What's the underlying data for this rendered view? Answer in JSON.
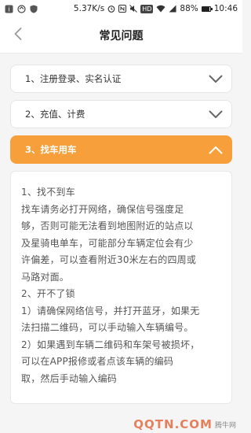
{
  "status_bar": {
    "speed": "5.37K/s",
    "battery": "88%",
    "battery_level": 0.88,
    "time": "10:46",
    "hd": "HD"
  },
  "header": {
    "back_icon": "chevron-left-icon",
    "title": "常见问题"
  },
  "faq": [
    {
      "label": "1、注册登录、实名认证",
      "expanded": false
    },
    {
      "label": "2、充值、计费",
      "expanded": false
    },
    {
      "label": "3、找车用车",
      "expanded": true
    }
  ],
  "answer_lines": [
    "1、找不到车",
    "找车请务必打开网络，确保信号强度足",
    "够，否则可能无法看到地图附近的站点以",
    "及星骑电单车，可能部分车辆定位会有少",
    "许偏差，可以查看附近30米左右的四周或",
    "马路对面。",
    "2、开不了锁",
    "1）请确保网络信号，并打开蓝牙，如果无",
    "法扫描二维码，可以手动输入车辆编号。",
    "2）如果遇到车辆二维码和车架号被损坏，",
    "可以在APP报修或者点该车辆的编码",
    "取，然后手动输入编码"
  ],
  "watermark": {
    "text": "QQTN.COM",
    "sub": "腾牛网"
  },
  "colors": {
    "accent": "#f7a03b",
    "text": "#333333",
    "chevron": "#666666"
  }
}
